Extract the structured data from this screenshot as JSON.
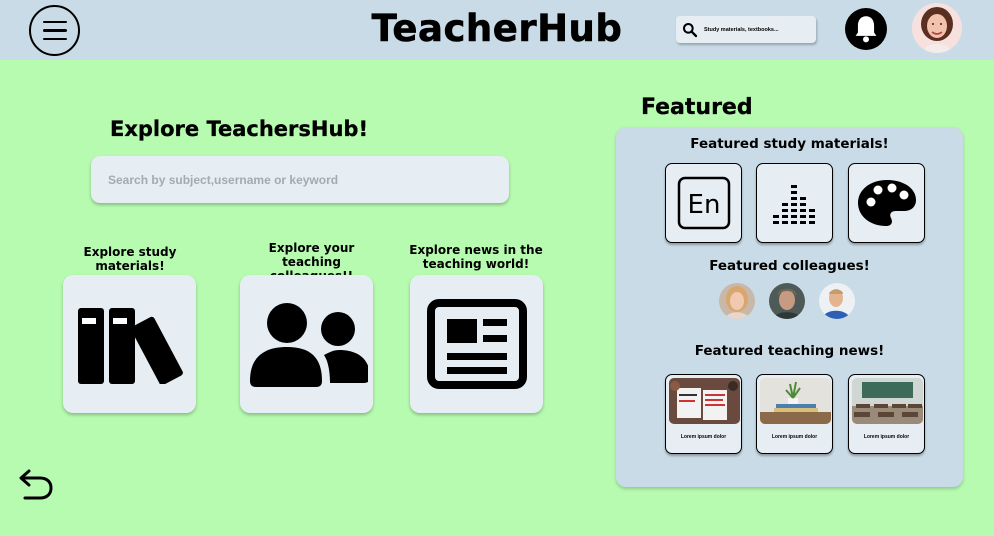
{
  "header": {
    "title": "TeacherHub",
    "search_placeholder": "Study materials, textbooks..."
  },
  "explore": {
    "title": "Explore TeachersHub!",
    "search_placeholder": "Search by subject,username or keyword",
    "categories": [
      {
        "label": "Explore study materials!",
        "icon": "books-icon"
      },
      {
        "label": "Explore your teaching colleagues!!",
        "icon": "people-icon"
      },
      {
        "label": "Explore news in the teaching world!",
        "icon": "newspaper-icon"
      }
    ]
  },
  "featured": {
    "title": "Featured",
    "materials_title": "Featured study materials!",
    "materials": [
      {
        "icon": "english-language-icon",
        "label": "En"
      },
      {
        "icon": "equalizer-icon"
      },
      {
        "icon": "art-palette-icon"
      }
    ],
    "colleagues_title": "Featured colleagues!",
    "news_title": "Featured teaching news!",
    "news": [
      {
        "caption": "Lorem ipsum dolor"
      },
      {
        "caption": "Lorem ipsum dolor"
      },
      {
        "caption": "Lorem ipsum dolor"
      }
    ]
  },
  "colors": {
    "background": "#b6fbb0",
    "header": "#c9dbe7",
    "card": "#e6eef3",
    "panel": "#c9dbe7"
  }
}
